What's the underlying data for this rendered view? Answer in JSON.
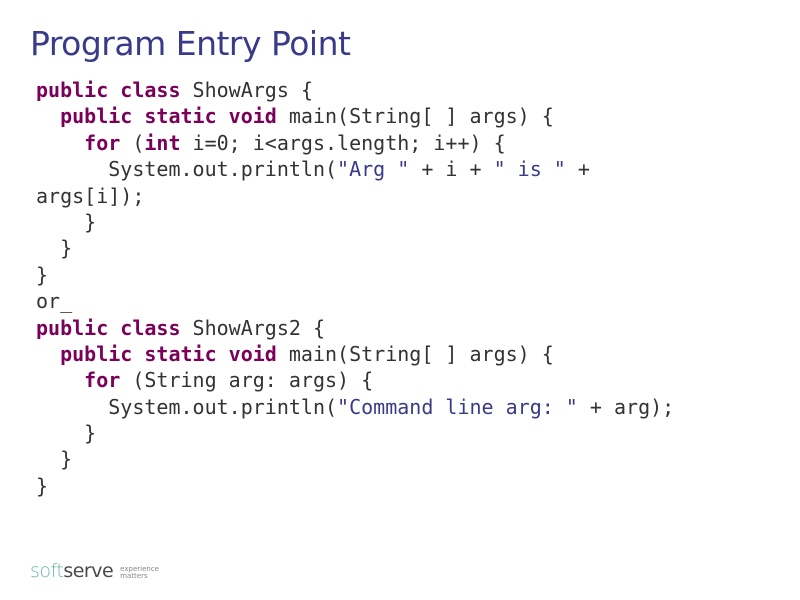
{
  "title": "Program Entry Point",
  "code": {
    "line1a": "public class",
    "line1b": " ShowArgs {",
    "line2a": "  public static void",
    "line2b": " main(String[ ] args) {",
    "line3a": "    for ",
    "line3b": "(",
    "line3c": "int",
    "line3d": " i=0; i<args.length; i++) {",
    "line4a": "      System.out.println(",
    "line4b": "\"Arg \"",
    "line4c": " + i + ",
    "line4d": "\" is \"",
    "line4e": " +",
    "line5": "args[i]);",
    "line6": "    }",
    "line7": "  }",
    "line8": "}",
    "line9": "or_",
    "line10a": "public class",
    "line10b": " ShowArgs2 {",
    "line11a": "  public static void",
    "line11b": " main(String[ ] args) {",
    "line12a": "    for ",
    "line12b": "(String arg: args) {",
    "line13a": "      System.out.println(",
    "line13b": "\"Command line arg: \"",
    "line13c": " + arg);",
    "line14": "    }",
    "line15": "  }",
    "line16": "}"
  },
  "logo": {
    "soft": "soft",
    "serve": "serve",
    "tagline1": "experience",
    "tagline2": "matters"
  }
}
